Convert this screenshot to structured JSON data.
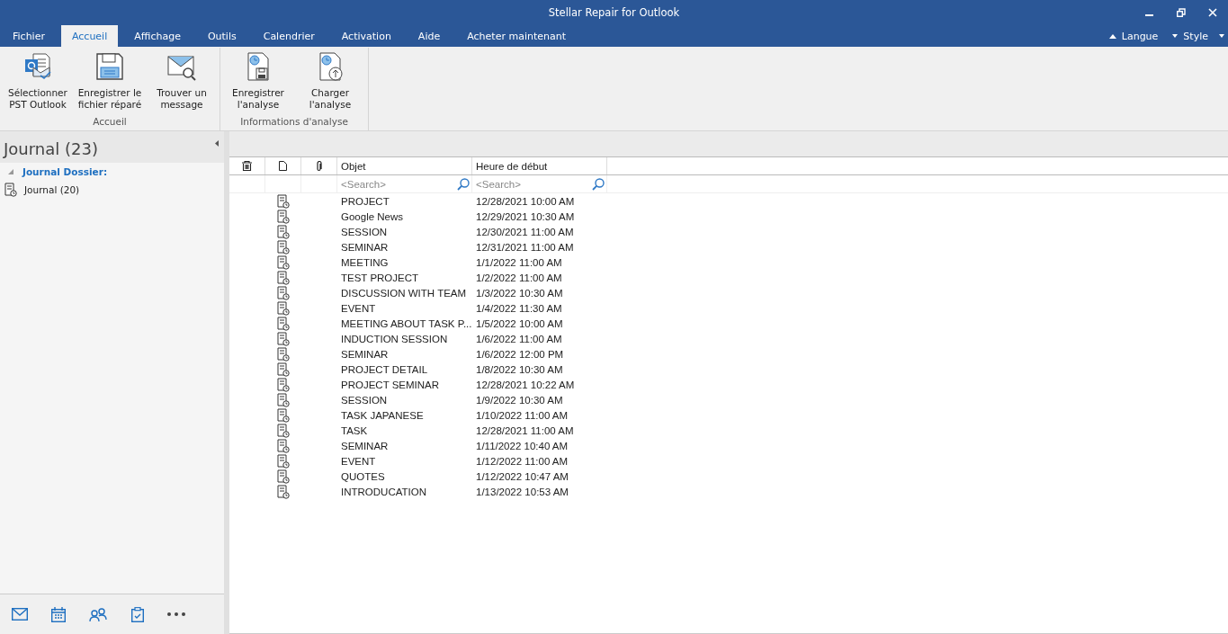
{
  "window": {
    "title": "Stellar Repair for Outlook"
  },
  "tabs": [
    {
      "label": "Fichier",
      "selected": false
    },
    {
      "label": "Accueil",
      "selected": true
    },
    {
      "label": "Affichage",
      "selected": false
    },
    {
      "label": "Outils",
      "selected": false
    },
    {
      "label": "Calendrier",
      "selected": false
    },
    {
      "label": "Activation",
      "selected": false
    },
    {
      "label": "Aide",
      "selected": false
    },
    {
      "label": "Acheter maintenant",
      "selected": false
    }
  ],
  "right_menus": [
    {
      "label": "Langue",
      "kind": "up"
    },
    {
      "label": "Style",
      "kind": "down"
    }
  ],
  "ribbon_groups": [
    {
      "label": "Accueil",
      "buttons": [
        {
          "label": "Sélectionner PST Outlook",
          "kind": "outlook"
        },
        {
          "label": "Enregistrer le fichier réparé",
          "kind": "save"
        },
        {
          "label": "Trouver un message",
          "kind": "find"
        }
      ]
    },
    {
      "label": "Informations d'analyse",
      "buttons": [
        {
          "label": "Enregistrer l'analyse",
          "kind": "save-scan"
        },
        {
          "label": "Charger l'analyse",
          "kind": "load-scan"
        }
      ]
    }
  ],
  "sidebar": {
    "title": "Journal (23)",
    "tree": [
      {
        "label": "Journal  Dossier:",
        "expanded": true,
        "children": [
          {
            "label": "Journal (20)"
          }
        ]
      }
    ]
  },
  "table": {
    "columns": [
      {
        "kind": "delete"
      },
      {
        "kind": "type"
      },
      {
        "kind": "attach"
      },
      {
        "kind": "text",
        "label": "Objet",
        "placeholder": "<Search>"
      },
      {
        "kind": "text",
        "label": "Heure de début",
        "placeholder": "<Search>"
      }
    ],
    "rows": [
      [
        "PROJECT",
        "12/28/2021 10:00 AM"
      ],
      [
        "Google News",
        "12/29/2021 10:30 AM"
      ],
      [
        "SESSION",
        "12/30/2021 11:00 AM"
      ],
      [
        "SEMINAR",
        "12/31/2021 11:00 AM"
      ],
      [
        "MEETING",
        "1/1/2022 11:00 AM"
      ],
      [
        "TEST PROJECT",
        "1/2/2022 11:00 AM"
      ],
      [
        "DISCUSSION WITH TEAM",
        "1/3/2022 10:30 AM"
      ],
      [
        "EVENT",
        "1/4/2022 11:30 AM"
      ],
      [
        "MEETING ABOUT TASK P...",
        "1/5/2022 10:00 AM"
      ],
      [
        "INDUCTION SESSION",
        "1/6/2022 11:00 AM"
      ],
      [
        "SEMINAR",
        "1/6/2022 12:00 PM"
      ],
      [
        "PROJECT DETAIL",
        "1/8/2022 10:30 AM"
      ],
      [
        "PROJECT SEMINAR",
        "12/28/2021 10:22 AM"
      ],
      [
        "SESSION",
        "1/9/2022 10:30 AM"
      ],
      [
        "TASK JAPANESE",
        "1/10/2022 11:00 AM"
      ],
      [
        "TASK",
        "12/28/2021 11:00 AM"
      ],
      [
        "SEMINAR",
        "1/11/2022 10:40 AM"
      ],
      [
        "EVENT",
        "1/12/2022 11:00 AM"
      ],
      [
        "QUOTES",
        "1/12/2022 10:47 AM"
      ],
      [
        "INTRODUCATION",
        "1/13/2022 10:53 AM"
      ]
    ]
  },
  "nav": [
    {
      "kind": "mail"
    },
    {
      "kind": "calendar"
    },
    {
      "kind": "people"
    },
    {
      "kind": "tasks"
    },
    {
      "kind": "more"
    }
  ]
}
